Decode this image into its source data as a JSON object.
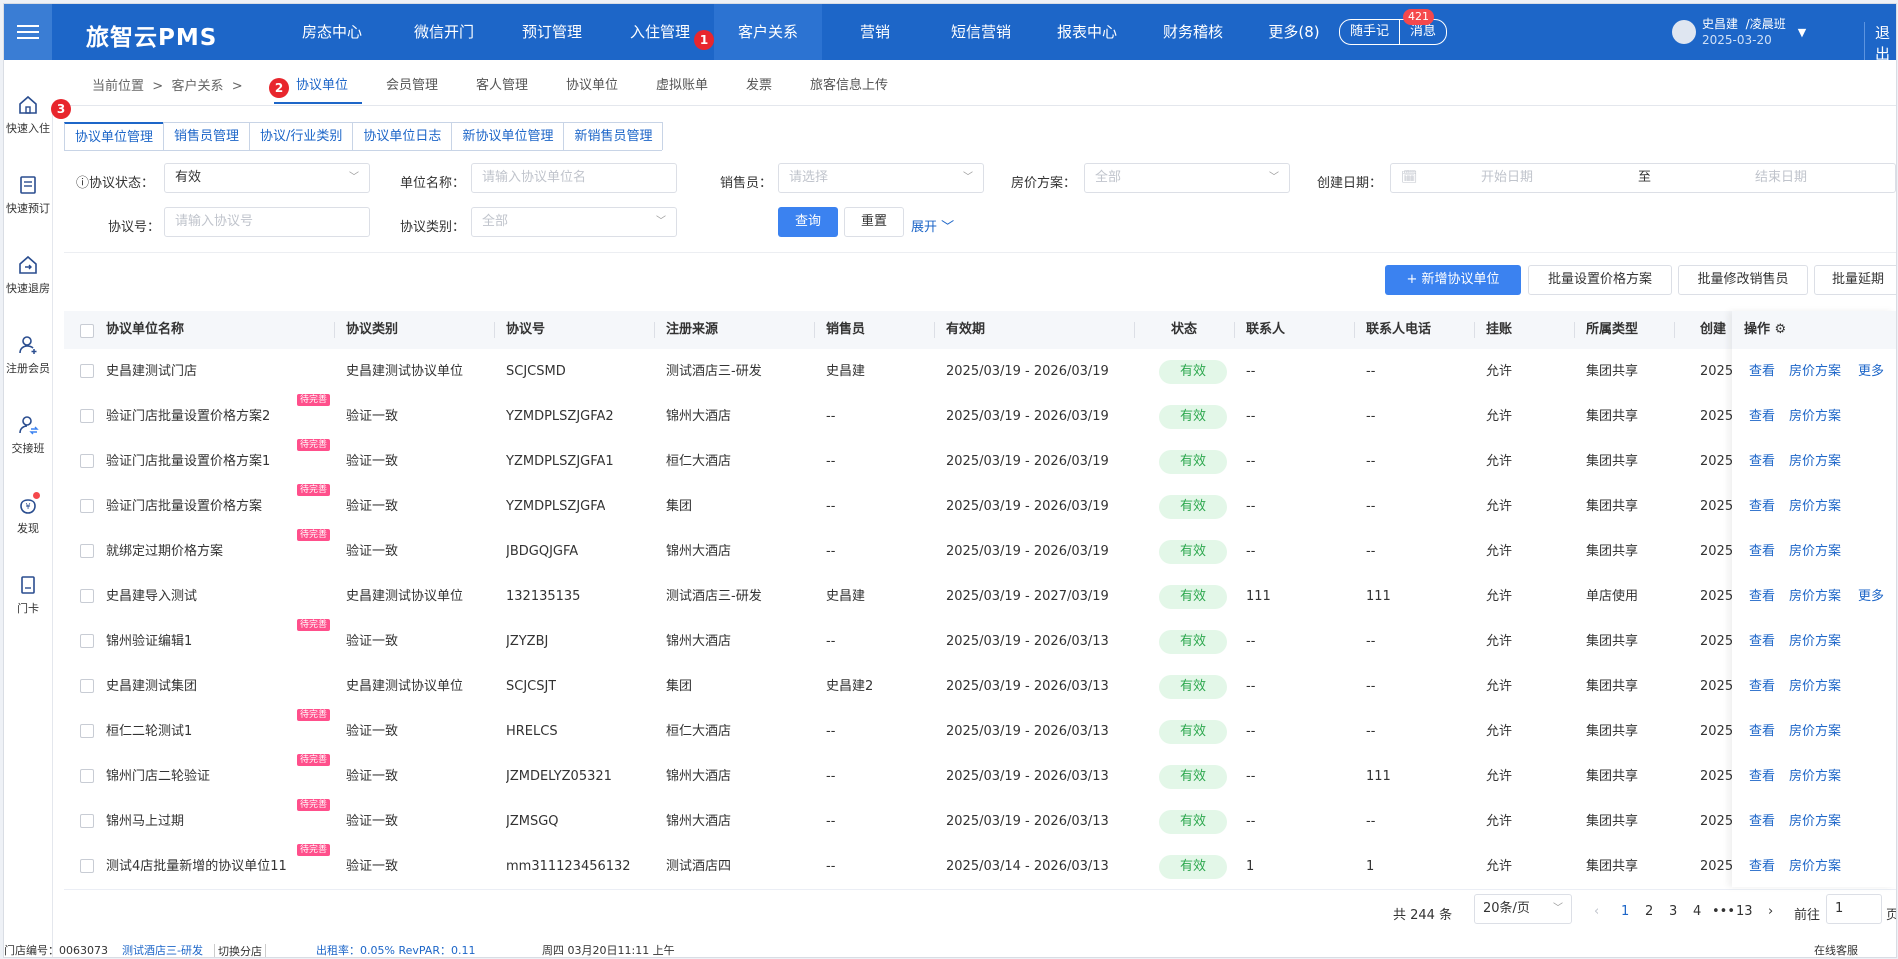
{
  "app": {
    "logo": "旅智云PMS",
    "nav": [
      "房态中心",
      "微信开门",
      "预订管理",
      "入住管理",
      "客户关系",
      "营销",
      "短信营销",
      "报表中心",
      "财务稽核",
      "更多(8)"
    ],
    "active_nav": "客户关系",
    "notes_label": "随手记",
    "messages_label": "消息",
    "message_count": "421",
    "user_name": "史昌建",
    "user_shift": "/凌晨班",
    "user_date": "2025-03-20",
    "logout": "退出"
  },
  "sidebar": [
    {
      "label": "快速入住",
      "icon": "home-icon"
    },
    {
      "label": "快速预订",
      "icon": "document-icon"
    },
    {
      "label": "快速退房",
      "icon": "checkout-icon"
    },
    {
      "label": "注册会员",
      "icon": "add-user-icon"
    },
    {
      "label": "交接班",
      "icon": "shift-swap-icon"
    },
    {
      "label": "发现",
      "icon": "discover-icon"
    },
    {
      "label": "门卡",
      "icon": "card-icon"
    }
  ],
  "breadcrumb": {
    "prefix": "当前位置",
    "sep": ">",
    "path": "客户关系",
    "tabs": [
      "协议单位",
      "会员管理",
      "客人管理",
      "协议单位",
      "虚拟账单",
      "发票",
      "旅客信息上传"
    ]
  },
  "markers": [
    "1",
    "2",
    "3"
  ],
  "subtabs": [
    "协议单位管理",
    "销售员管理",
    "协议/行业类别",
    "协议单位日志",
    "新协议单位管理",
    "新销售员管理"
  ],
  "filters": {
    "status_label": "协议状态：",
    "status_value": "有效",
    "name_label": "单位名称：",
    "name_placeholder": "请输入协议单位名",
    "sales_label": "销售员：",
    "sales_placeholder": "请选择",
    "plan_label": "房价方案：",
    "plan_placeholder": "全部",
    "date_label": "创建日期：",
    "date_start": "开始日期",
    "date_to": "至",
    "date_end": "结束日期",
    "no_label": "协议号：",
    "no_placeholder": "请输入协议号",
    "type_label": "协议类别：",
    "type_placeholder": "全部",
    "query": "查询",
    "reset": "重置",
    "expand": "展开"
  },
  "actions": {
    "add": "+ 新增协议单位",
    "batch_price": "批量设置价格方案",
    "batch_sales": "批量修改销售员",
    "batch_extend": "批量延期"
  },
  "table": {
    "headers": [
      "协议单位名称",
      "协议类别",
      "协议号",
      "注册来源",
      "销售员",
      "有效期",
      "状态",
      "联系人",
      "联系人电话",
      "挂账",
      "所属类型",
      "创建",
      "操作"
    ],
    "pending_tag": "待完善",
    "op_view": "查看",
    "op_price": "房价方案",
    "op_more": "更多",
    "rows": [
      {
        "name": "史昌建测试门店",
        "pending": false,
        "type": "史昌建测试协议单位",
        "no": "SCJCSMD",
        "source": "测试酒店三-研发",
        "sales": "史昌建",
        "period": "2025/03/19 - 2026/03/19",
        "status": "有效",
        "contact": "--",
        "phone": "--",
        "credit": "允许",
        "scope": "集团共享",
        "created": "2025",
        "more": true
      },
      {
        "name": "验证门店批量设置价格方案2",
        "pending": true,
        "type": "验证一致",
        "no": "YZMDPLSZJGFA2",
        "source": "锦州大酒店",
        "sales": "--",
        "period": "2025/03/19 - 2026/03/19",
        "status": "有效",
        "contact": "--",
        "phone": "--",
        "credit": "允许",
        "scope": "集团共享",
        "created": "2025",
        "more": false
      },
      {
        "name": "验证门店批量设置价格方案1",
        "pending": true,
        "type": "验证一致",
        "no": "YZMDPLSZJGFA1",
        "source": "桓仁大酒店",
        "sales": "--",
        "period": "2025/03/19 - 2026/03/19",
        "status": "有效",
        "contact": "--",
        "phone": "--",
        "credit": "允许",
        "scope": "集团共享",
        "created": "2025",
        "more": false
      },
      {
        "name": "验证门店批量设置价格方案",
        "pending": true,
        "type": "验证一致",
        "no": "YZMDPLSZJGFA",
        "source": "集团",
        "sales": "--",
        "period": "2025/03/19 - 2026/03/19",
        "status": "有效",
        "contact": "--",
        "phone": "--",
        "credit": "允许",
        "scope": "集团共享",
        "created": "2025",
        "more": false
      },
      {
        "name": "就绑定过期价格方案",
        "pending": true,
        "type": "验证一致",
        "no": "JBDGQJGFA",
        "source": "锦州大酒店",
        "sales": "--",
        "period": "2025/03/19 - 2026/03/19",
        "status": "有效",
        "contact": "--",
        "phone": "--",
        "credit": "允许",
        "scope": "集团共享",
        "created": "2025",
        "more": false
      },
      {
        "name": "史昌建导入测试",
        "pending": false,
        "type": "史昌建测试协议单位",
        "no": "132135135",
        "source": "测试酒店三-研发",
        "sales": "史昌建",
        "period": "2025/03/19 - 2027/03/19",
        "status": "有效",
        "contact": "111",
        "phone": "111",
        "credit": "允许",
        "scope": "单店使用",
        "created": "2025",
        "more": true
      },
      {
        "name": "锦州验证编辑1",
        "pending": true,
        "type": "验证一致",
        "no": "JZYZBJ",
        "source": "锦州大酒店",
        "sales": "--",
        "period": "2025/03/19 - 2026/03/13",
        "status": "有效",
        "contact": "--",
        "phone": "--",
        "credit": "允许",
        "scope": "集团共享",
        "created": "2025",
        "more": false
      },
      {
        "name": "史昌建测试集团",
        "pending": false,
        "type": "史昌建测试协议单位",
        "no": "SCJCSJT",
        "source": "集团",
        "sales": "史昌建2",
        "period": "2025/03/19 - 2026/03/13",
        "status": "有效",
        "contact": "--",
        "phone": "--",
        "credit": "允许",
        "scope": "集团共享",
        "created": "2025",
        "more": false
      },
      {
        "name": "桓仁二轮测试1",
        "pending": true,
        "type": "验证一致",
        "no": "HRELCS",
        "source": "桓仁大酒店",
        "sales": "--",
        "period": "2025/03/19 - 2026/03/13",
        "status": "有效",
        "contact": "--",
        "phone": "--",
        "credit": "允许",
        "scope": "集团共享",
        "created": "2025",
        "more": false
      },
      {
        "name": "锦州门店二轮验证",
        "pending": true,
        "type": "验证一致",
        "no": "JZMDELYZ05321",
        "source": "锦州大酒店",
        "sales": "--",
        "period": "2025/03/19 - 2026/03/13",
        "status": "有效",
        "contact": "--",
        "phone": "111",
        "credit": "允许",
        "scope": "集团共享",
        "created": "2025",
        "more": false
      },
      {
        "name": "锦州马上过期",
        "pending": true,
        "type": "验证一致",
        "no": "JZMSGQ",
        "source": "锦州大酒店",
        "sales": "--",
        "period": "2025/03/19 - 2026/03/13",
        "status": "有效",
        "contact": "--",
        "phone": "--",
        "credit": "允许",
        "scope": "集团共享",
        "created": "2025",
        "more": false
      },
      {
        "name": "测试4店批量新增的协议单位11",
        "pending": true,
        "type": "验证一致",
        "no": "mm311123456132",
        "source": "测试酒店四",
        "sales": "--",
        "period": "2025/03/14 - 2026/03/13",
        "status": "有效",
        "contact": "1",
        "phone": "1",
        "credit": "允许",
        "scope": "集团共享",
        "created": "2025",
        "more": false
      }
    ]
  },
  "pagination": {
    "total": "共 244 条",
    "page_size": "20条/页",
    "pages": [
      "1",
      "2",
      "3",
      "4",
      "•••",
      "13"
    ],
    "current": "1",
    "goto_label": "前往",
    "goto_value": "1",
    "goto_suffix": "页"
  },
  "statusbar": {
    "left": "门店编号：0063073",
    "hotel": "测试酒店三-研发",
    "switch": "切换分店",
    "rate": "出租率：0.05% RevPAR：0.11",
    "time": "周四 03月20日11:11 上午",
    "service": "在线客服"
  },
  "colors": {
    "primary": "#1d66c8",
    "button": "#3b82f0",
    "status_bg": "#e3f7e8",
    "status_text": "#2ea84f",
    "pending_tag": "#ff4f8b",
    "marker": "#e8262d"
  }
}
